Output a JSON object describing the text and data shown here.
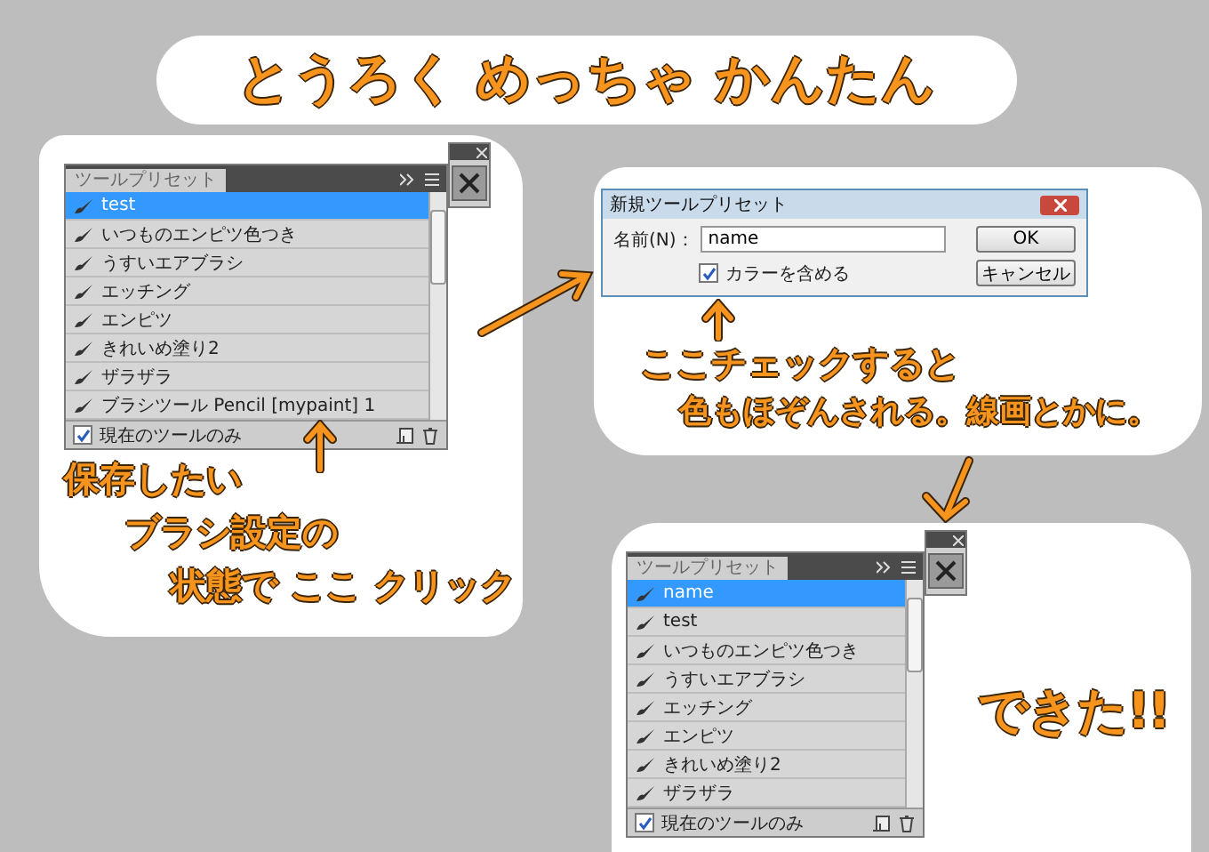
{
  "title": "とうろく めっちゃ かんたん",
  "panel_before": {
    "tab": "ツールプリセット",
    "items": [
      {
        "label": "test",
        "selected": true
      },
      {
        "label": "いつものエンピツ色つき",
        "selected": false
      },
      {
        "label": "うすいエアブラシ",
        "selected": false
      },
      {
        "label": "エッチング",
        "selected": false
      },
      {
        "label": "エンピツ",
        "selected": false
      },
      {
        "label": "きれいめ塗り2",
        "selected": false
      },
      {
        "label": "ザラザラ",
        "selected": false
      },
      {
        "label": "ブラシツール Pencil [mypaint] 1",
        "selected": false
      }
    ],
    "current_only": {
      "label": "現在のツールのみ",
      "checked": true
    }
  },
  "note_1": [
    "保存したい",
    "ブラシ設定の",
    "状態で ここ クリック"
  ],
  "dialog": {
    "title": "新規ツールプリセット",
    "name_label": "名前(N)：",
    "name_value": "name",
    "include_color": {
      "label": "カラーを含める",
      "checked": true
    },
    "ok": "OK",
    "cancel": "キャンセル"
  },
  "note_2": [
    "ここチェックすると",
    "色もほぞんされる。線画とかに。"
  ],
  "panel_after": {
    "tab": "ツールプリセット",
    "items": [
      {
        "label": "name",
        "selected": true
      },
      {
        "label": "test",
        "selected": false
      },
      {
        "label": "いつものエンピツ色つき",
        "selected": false
      },
      {
        "label": "うすいエアブラシ",
        "selected": false
      },
      {
        "label": "エッチング",
        "selected": false
      },
      {
        "label": "エンピツ",
        "selected": false
      },
      {
        "label": "きれいめ塗り2",
        "selected": false
      },
      {
        "label": "ザラザラ",
        "selected": false
      }
    ],
    "current_only": {
      "label": "現在のツールのみ",
      "checked": true
    }
  },
  "note_3": "できた!!"
}
